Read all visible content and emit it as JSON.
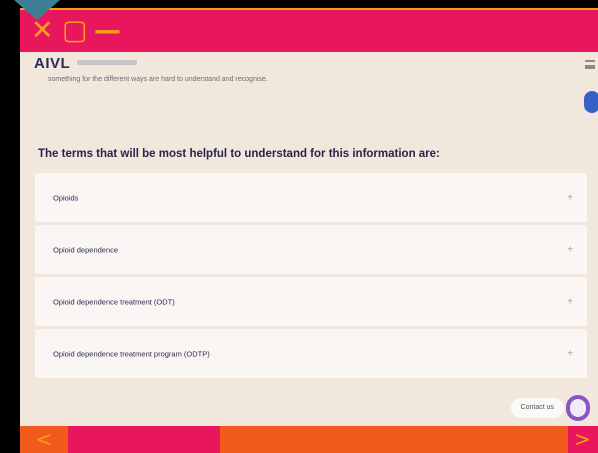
{
  "window": {
    "controls": {
      "close": "✕",
      "maximize": "▢",
      "minimize": "—"
    },
    "accent_color": "#e8175d",
    "secondary_color": "#f7a11a"
  },
  "header": {
    "logo": "AIVL"
  },
  "main": {
    "cut_text": "something for the different ways are hard to understand and recognise.",
    "question": "The terms that will be most helpful to understand for this information are:",
    "terms": [
      {
        "label": "Opioids"
      },
      {
        "label": "Opioid dependence"
      },
      {
        "label": "Opioid dependence treatment (ODT)"
      },
      {
        "label": "Opioid dependence treatment program (ODTP)"
      }
    ],
    "expand_glyph": "+",
    "contact_label": "Contact us"
  },
  "footer": {
    "prev_glyph": "<",
    "next_glyph": ">",
    "progress": 0.31
  }
}
